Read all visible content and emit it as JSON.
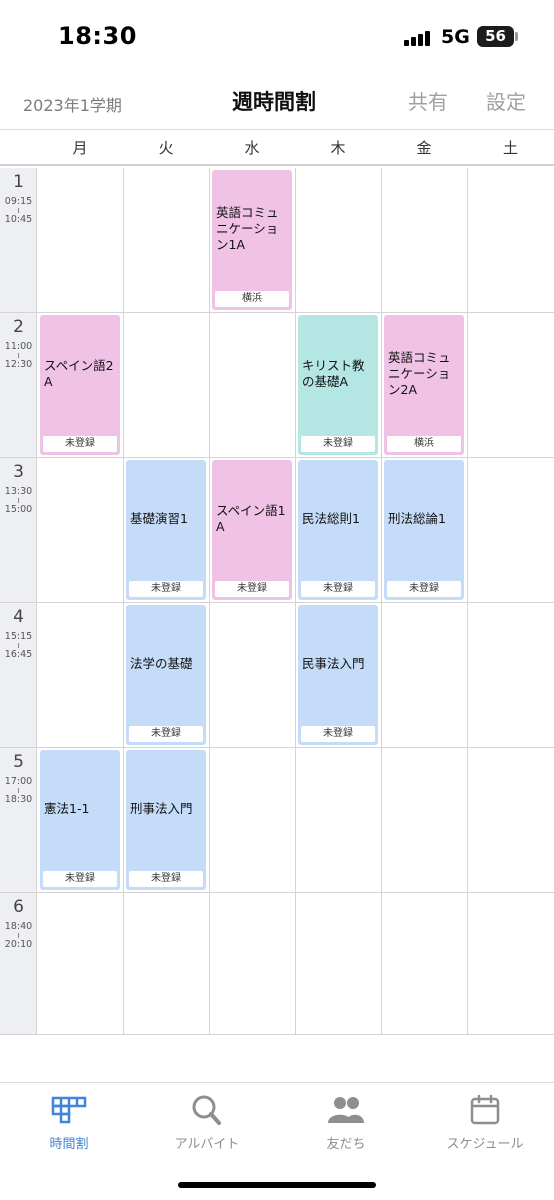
{
  "status_bar": {
    "time": "18:30",
    "network": "5G",
    "battery": "56"
  },
  "header": {
    "term": "2023年1学期",
    "title": "週時間割",
    "share_label": "共有",
    "settings_label": "設定"
  },
  "days": [
    "月",
    "火",
    "水",
    "木",
    "金",
    "土"
  ],
  "periods": [
    {
      "number": "1",
      "start": "09:15",
      "end": "10:45"
    },
    {
      "number": "2",
      "start": "11:00",
      "end": "12:30"
    },
    {
      "number": "3",
      "start": "13:30",
      "end": "15:00"
    },
    {
      "number": "4",
      "start": "15:15",
      "end": "16:45"
    },
    {
      "number": "5",
      "start": "17:00",
      "end": "18:30"
    },
    {
      "number": "6",
      "start": "18:40",
      "end": "20:10"
    }
  ],
  "colors": {
    "pink": "#f0c2e6",
    "blue": "#c4dcf7",
    "teal": "#b4e6e3",
    "accent": "#3f86d8"
  },
  "courses": [
    {
      "name": "英語コミュニケーション1A",
      "room": "横浜",
      "color": "pink"
    },
    {
      "name": "スペイン語2A",
      "room": "未登録",
      "color": "pink"
    },
    {
      "name": "キリスト教の基礎A",
      "room": "未登録",
      "color": "teal"
    },
    {
      "name": "英語コミュニケーション2A",
      "room": "横浜",
      "color": "pink"
    },
    {
      "name": "基礎演習1",
      "room": "未登録",
      "color": "blue"
    },
    {
      "name": "スペイン語1A",
      "room": "未登録",
      "color": "pink"
    },
    {
      "name": "民法総則1",
      "room": "未登録",
      "color": "blue"
    },
    {
      "name": "刑法総論1",
      "room": "未登録",
      "color": "blue"
    },
    {
      "name": "法学の基礎",
      "room": "未登録",
      "color": "blue"
    },
    {
      "name": "民事法入門",
      "room": "未登録",
      "color": "blue"
    },
    {
      "name": "憲法1-1",
      "room": "未登録",
      "color": "blue"
    },
    {
      "name": "刑事法入門",
      "room": "未登録",
      "color": "blue"
    }
  ],
  "tabs": [
    {
      "label": "時間割",
      "icon": "timetable-icon",
      "active": true
    },
    {
      "label": "アルバイト",
      "icon": "search-icon",
      "active": false
    },
    {
      "label": "友だち",
      "icon": "friends-icon",
      "active": false
    },
    {
      "label": "スケジュール",
      "icon": "calendar-icon",
      "active": false
    }
  ]
}
